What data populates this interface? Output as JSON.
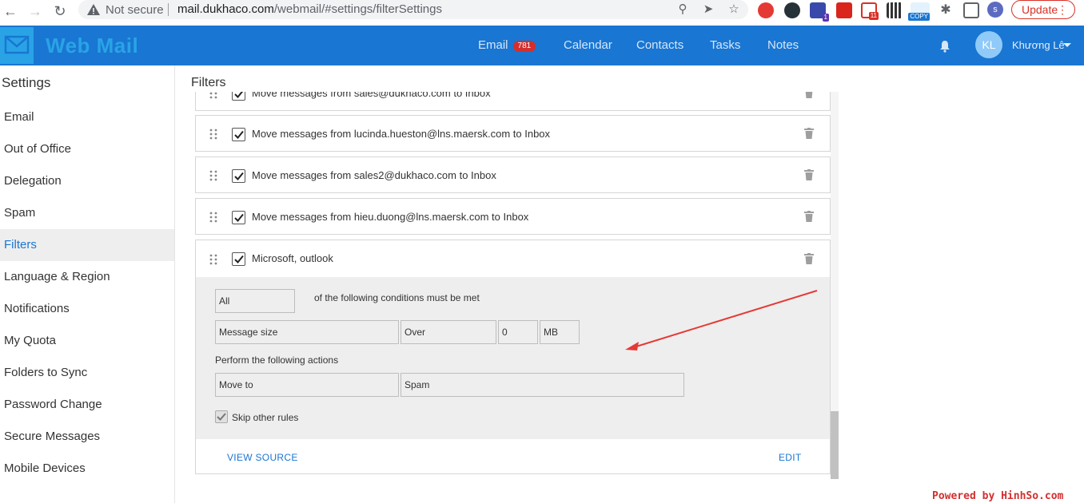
{
  "browser": {
    "not_secure": "Not secure",
    "url_host": "mail.dukhaco.com",
    "url_path": "/webmail/#settings/filterSettings",
    "update_label": "Update",
    "profile_initial": "s",
    "ext_badges": [
      "1",
      "11",
      "COPY"
    ]
  },
  "app": {
    "logo_text": "Web Mail",
    "nav": [
      {
        "label": "Email",
        "badge": "781"
      },
      {
        "label": "Calendar"
      },
      {
        "label": "Contacts"
      },
      {
        "label": "Tasks"
      },
      {
        "label": "Notes"
      }
    ],
    "user_initials": "KL",
    "user_name": "Khương Lê"
  },
  "sidebar": {
    "title": "Settings",
    "items": [
      "Email",
      "Out of Office",
      "Delegation",
      "Spam",
      "Filters",
      "Language & Region",
      "Notifications",
      "My Quota",
      "Folders to Sync",
      "Password Change",
      "Secure Messages",
      "Mobile Devices"
    ],
    "active": "Filters"
  },
  "main": {
    "title": "Filters",
    "filters": [
      "Move messages from sales@dukhaco.com to Inbox",
      "Move messages from lucinda.hueston@lns.maersk.com to Inbox",
      "Move messages from sales2@dukhaco.com to Inbox",
      "Move messages from hieu.duong@lns.maersk.com to Inbox"
    ],
    "expanded": {
      "label": "Microsoft, outlook",
      "match_value": "All",
      "condition_text": "of the following conditions must be met",
      "condition": {
        "field": "Message size",
        "operator": "Over",
        "value": "0",
        "unit": "MB"
      },
      "actions_label": "Perform the following actions",
      "action": {
        "type": "Move to",
        "target": "Spam"
      },
      "skip_label": "Skip other rules",
      "view_source": "VIEW SOURCE",
      "edit": "EDIT"
    }
  },
  "watermark": "Powered by HinhSo.com"
}
